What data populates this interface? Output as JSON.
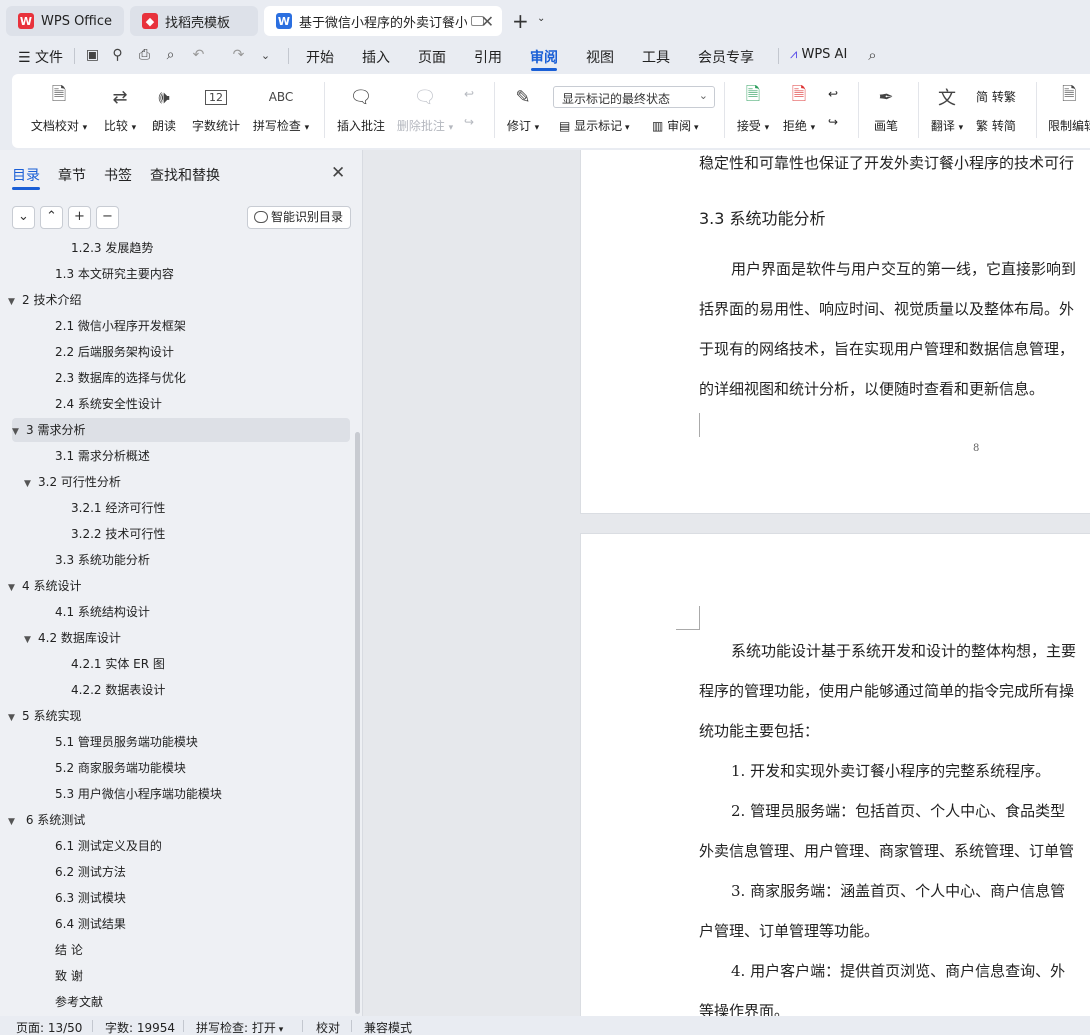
{
  "tabs": [
    {
      "label": "WPS Office",
      "icon": "wps-logo-icon"
    },
    {
      "label": "找稻壳模板",
      "icon": "docer-icon"
    },
    {
      "label": "基于微信小程序的外卖订餐小程序",
      "icon": "writer-doc-icon"
    }
  ],
  "menu": {
    "file": "文件",
    "items": [
      "开始",
      "插入",
      "页面",
      "引用",
      "审阅",
      "视图",
      "工具",
      "会员专享"
    ],
    "active": "审阅",
    "wps_ai": "WPS AI"
  },
  "ribbon": {
    "doc_proofread": "文档校对",
    "compare": "比较",
    "read_aloud": "朗读",
    "word_count": "字数统计",
    "spell_check": "拼写检查",
    "insert_comment": "插入批注",
    "delete_comment": "删除批注",
    "track_changes": "修订",
    "markup_select": "显示标记的最终状态",
    "show_markup": "显示标记",
    "review": "审阅",
    "accept": "接受",
    "reject": "拒绝",
    "pen": "画笔",
    "translate": "翻译",
    "to_traditional": "转繁",
    "to_simplified": "转简",
    "restrict_edit": "限制编辑",
    "spell_icon_text": "ABC",
    "count_icon_text": "12"
  },
  "sidepanel": {
    "tabs": [
      "目录",
      "章节",
      "书签",
      "查找和替换"
    ],
    "active_tab": "目录",
    "smart_toc": "智能识别目录",
    "toc": [
      {
        "text": "1.2.3  发展趋势",
        "level": 3,
        "tri": ""
      },
      {
        "text": "1.3  本文研究主要内容",
        "level": 2,
        "tri": ""
      },
      {
        "text": "2  技术介绍",
        "level": 1,
        "tri": "▼"
      },
      {
        "text": "2.1  微信小程序开发框架",
        "level": 2,
        "tri": ""
      },
      {
        "text": "2.2  后端服务架构设计",
        "level": 2,
        "tri": ""
      },
      {
        "text": "2.3  数据库的选择与优化",
        "level": 2,
        "tri": ""
      },
      {
        "text": "2.4  系统安全性设计",
        "level": 2,
        "tri": ""
      },
      {
        "text": "3  需求分析",
        "level": 1,
        "tri": "▼",
        "selected": true
      },
      {
        "text": "3.1  需求分析概述",
        "level": 2,
        "tri": ""
      },
      {
        "text": "3.2  可行性分析",
        "level": 2,
        "tri": "▼"
      },
      {
        "text": "3.2.1  经济可行性",
        "level": 3,
        "tri": ""
      },
      {
        "text": "3.2.2  技术可行性",
        "level": 3,
        "tri": ""
      },
      {
        "text": "3.3  系统功能分析",
        "level": 2,
        "tri": ""
      },
      {
        "text": "4  系统设计",
        "level": 1,
        "tri": "▼"
      },
      {
        "text": "4.1 系统结构设计",
        "level": 2,
        "tri": ""
      },
      {
        "text": "4.2  数据库设计",
        "level": 2,
        "tri": "▼"
      },
      {
        "text": "4.2.1  实体 ER 图",
        "level": 3,
        "tri": ""
      },
      {
        "text": "4.2.2  数据表设计",
        "level": 3,
        "tri": ""
      },
      {
        "text": "5  系统实现",
        "level": 1,
        "tri": "▼"
      },
      {
        "text": "5.1  管理员服务端功能模块",
        "level": 2,
        "tri": ""
      },
      {
        "text": "5.2  商家服务端功能模块",
        "level": 2,
        "tri": ""
      },
      {
        "text": "5.3 用户微信小程序端功能模块",
        "level": 2,
        "tri": ""
      },
      {
        "text": " 6  系统测试",
        "level": 1,
        "tri": "▼"
      },
      {
        "text": "6.1  测试定义及目的",
        "level": 2,
        "tri": ""
      },
      {
        "text": "6.2  测试方法",
        "level": 2,
        "tri": ""
      },
      {
        "text": "6.3  测试模块",
        "level": 2,
        "tri": ""
      },
      {
        "text": "6.4  测试结果",
        "level": 2,
        "tri": ""
      },
      {
        "text": "结   论",
        "level": 0,
        "tri": ""
      },
      {
        "text": "致   谢",
        "level": 0,
        "tri": ""
      },
      {
        "text": "参考文献",
        "level": 0,
        "tri": ""
      }
    ]
  },
  "document": {
    "page1": {
      "line0": "稳定性和可靠性也保证了开发外卖订餐小程序的技术可行",
      "heading": "3.3  系统功能分析",
      "lines": [
        "用户界面是软件与用户交互的第一线，它直接影响到",
        "括界面的易用性、响应时间、视觉质量以及整体布局。外",
        "于现有的网络技术，旨在实现用户管理和数据信息管理，",
        "的详细视图和统计分析，以便随时查看和更新信息。"
      ],
      "page_number": "8"
    },
    "page2": {
      "lines": [
        "系统功能设计基于系统开发和设计的整体构想，主要",
        "程序的管理功能，使用户能够通过简单的指令完成所有操",
        "统功能主要包括：",
        "1. 开发和实现外卖订餐小程序的完整系统程序。",
        "2. 管理员服务端：包括首页、个人中心、食品类型",
        "外卖信息管理、用户管理、商家管理、系统管理、订单管",
        "3. 商家服务端：涵盖首页、个人中心、商户信息管",
        "户管理、订单管理等功能。",
        "4. 用户客户端：提供首页浏览、商户信息查询、外",
        "等操作界面。"
      ]
    }
  },
  "statusbar": {
    "page": "页面: 13/50",
    "words": "字数: 19954",
    "spell": "拼写检查: 打开",
    "proofread": "校对",
    "compat": "兼容模式"
  },
  "colors": {
    "accent": "#1a5fd6",
    "wps_red": "#e8323c",
    "writer_blue": "#2b6fe0"
  }
}
